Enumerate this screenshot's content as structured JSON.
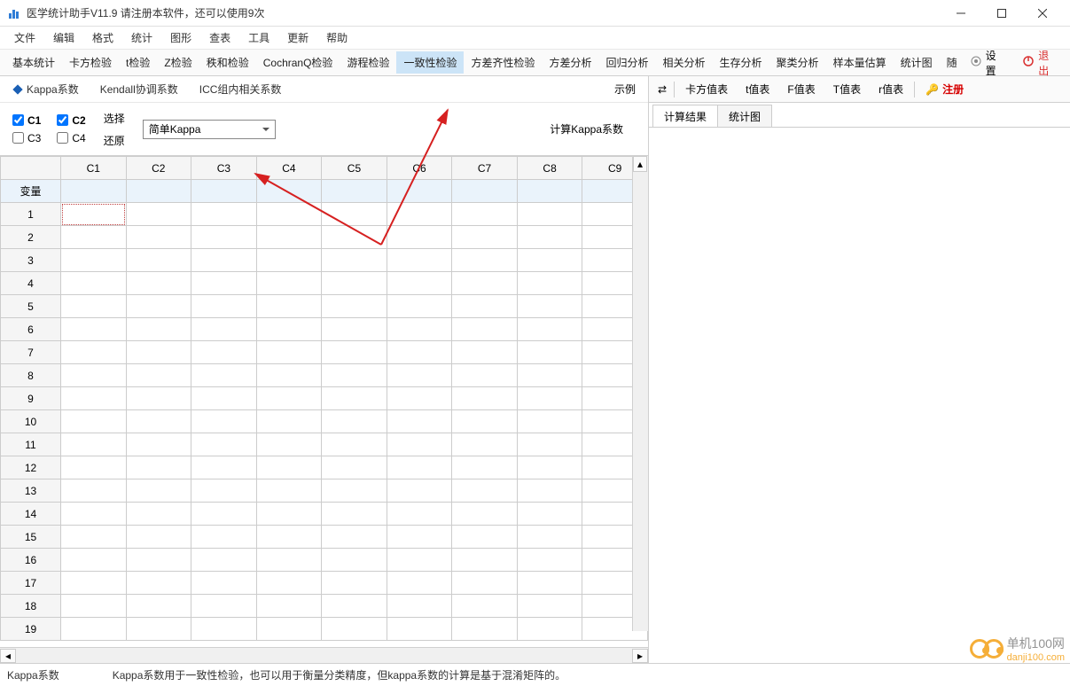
{
  "title": "医学统计助手V11.9     请注册本软件，还可以使用9次",
  "menu": [
    "文件",
    "编辑",
    "格式",
    "统计",
    "图形",
    "查表",
    "工具",
    "更新",
    "帮助"
  ],
  "tools": {
    "items": [
      "基本统计",
      "卡方检验",
      "t检验",
      "Z检验",
      "秩和检验",
      "CochranQ检验",
      "游程检验",
      "一致性检验",
      "方差齐性检验",
      "方差分析",
      "回归分析",
      "相关分析",
      "生存分析",
      "聚类分析",
      "样本量估算",
      "统计图",
      "随"
    ],
    "active_index": 7,
    "settings": "设置",
    "exit": "退出"
  },
  "left_tabs": {
    "items": [
      "Kappa系数",
      "Kendall协调系数",
      "ICC组内相关系数"
    ],
    "active_index": 0,
    "example": "示例"
  },
  "controls": {
    "checks": [
      {
        "label": "C1",
        "checked": true,
        "bold": true
      },
      {
        "label": "C2",
        "checked": true,
        "bold": true
      },
      {
        "label": "C3",
        "checked": false,
        "bold": false
      },
      {
        "label": "C4",
        "checked": false,
        "bold": false
      }
    ],
    "select_label": "选择",
    "restore_label": "还原",
    "combo_value": "简单Kappa",
    "calc_button": "计算Kappa系数"
  },
  "grid": {
    "columns": [
      "C1",
      "C2",
      "C3",
      "C4",
      "C5",
      "C6",
      "C7",
      "C8",
      "C9"
    ],
    "var_label": "变量",
    "rows": [
      1,
      2,
      3,
      4,
      5,
      6,
      7,
      8,
      9,
      10,
      11,
      12,
      13,
      14,
      15,
      16,
      17,
      18,
      19
    ]
  },
  "right_tabs": {
    "items": [
      "卡方值表",
      "t值表",
      "F值表",
      "T值表",
      "r值表"
    ],
    "register": "注册"
  },
  "result_tabs": {
    "items": [
      "计算结果",
      "统计图"
    ],
    "active_index": 0
  },
  "status": {
    "left": "Kappa系数",
    "right": "Kappa系数用于一致性检验，也可以用于衡量分类精度，但kappa系数的计算是基于混淆矩阵的。"
  },
  "watermark": {
    "line1": "单机100网",
    "line2": "danji100.com"
  }
}
